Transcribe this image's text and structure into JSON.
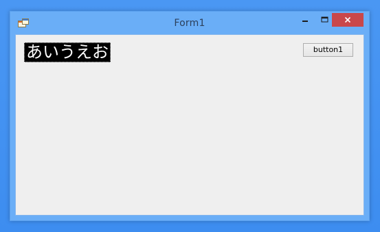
{
  "window": {
    "title": "Form1"
  },
  "controls": {
    "minimize_icon": "minimize-icon",
    "maximize_icon": "maximize-icon",
    "close_icon": "close-icon"
  },
  "form": {
    "label_text": "あいうえお",
    "button_label": "button1"
  },
  "colors": {
    "titlebar": "#6aaef7",
    "close_button": "#c9474a",
    "client_bg": "#efefef",
    "label_bg": "#000000",
    "label_fg": "#ffffff",
    "desktop": "#3c8cf0"
  }
}
